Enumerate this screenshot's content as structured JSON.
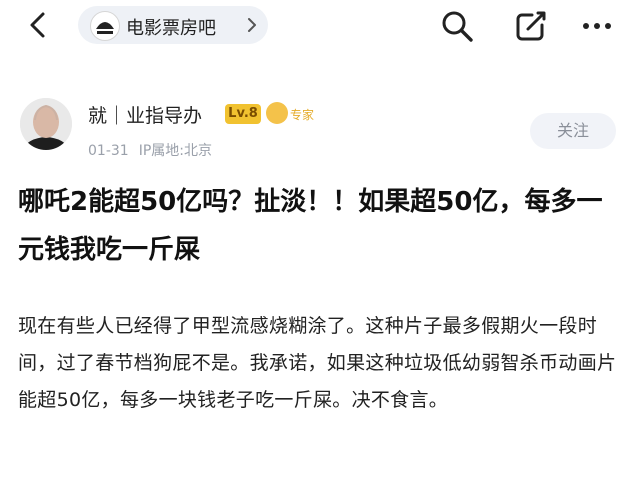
{
  "header": {
    "forum_name": "电影票房吧",
    "icons": [
      "back-arrow-icon",
      "search-icon",
      "edit-icon",
      "more-icon"
    ]
  },
  "post": {
    "author": "就｜业指导办",
    "level_badge": "Lv.8",
    "expert_badge": "专家",
    "date": "01-31",
    "ip_location": "IP属地:北京",
    "follow_label": "关注",
    "title": "哪吒2能超50亿吗？扯淡！！如果超50亿，每多一元钱我吃一斤屎",
    "body": "现在有些人已经得了甲型流感烧糊涂了。这种片子最多假期火一段时间，过了春节档狗屁不是。我承诺，如果这种垃圾低幼弱智杀币动画片能超50亿，每多一块钱老子吃一斤屎。决不食言。"
  },
  "colors": {
    "level_badge_bg": "#f1c230",
    "expert_gold": "#e5ac2a",
    "meta_gray": "#9aa0aa",
    "pill_bg": "#eef1f6"
  }
}
